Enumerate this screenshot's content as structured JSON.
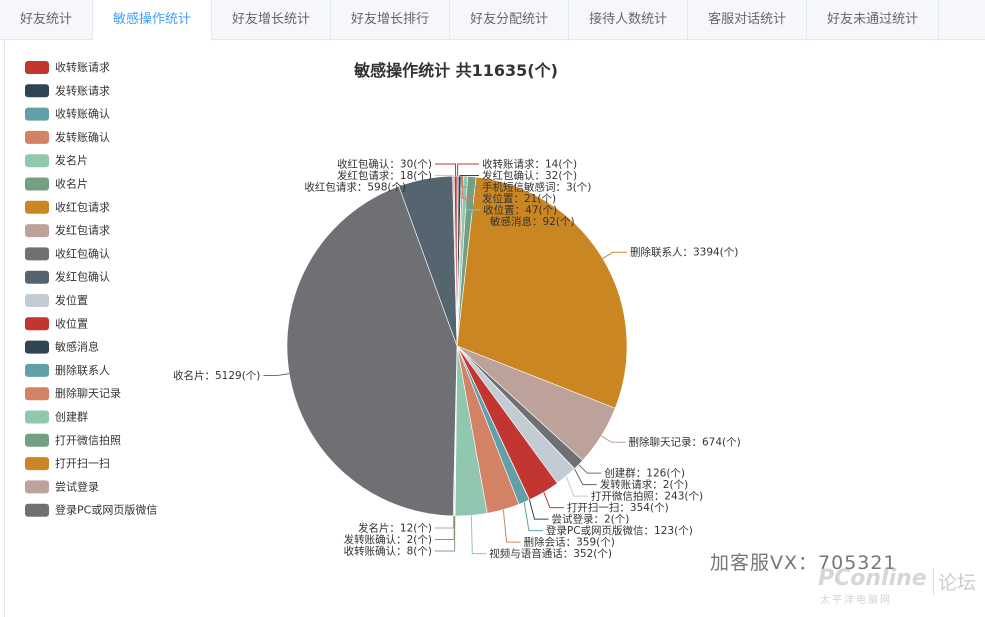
{
  "tabs": [
    {
      "label": "好友统计",
      "active": false
    },
    {
      "label": "敏感操作统计",
      "active": true
    },
    {
      "label": "好友增长统计",
      "active": false
    },
    {
      "label": "好友增长排行",
      "active": false
    },
    {
      "label": "好友分配统计",
      "active": false
    },
    {
      "label": "接待人数统计",
      "active": false
    },
    {
      "label": "客服对话统计",
      "active": false
    },
    {
      "label": "好友未通过统计",
      "active": false
    }
  ],
  "watermark": {
    "contact": "加客服VX：705321",
    "logo": "PConline",
    "logo_sub": "太平洋电脑网",
    "forum": "论坛"
  },
  "chart_data": {
    "type": "pie",
    "title": "敏感操作统计 共11635(个)",
    "unit": "(个)",
    "legend_position": "left",
    "legend": [
      {
        "name": "收转账请求",
        "color": "#c23531"
      },
      {
        "name": "发转账请求",
        "color": "#2f4554"
      },
      {
        "name": "收转账确认",
        "color": "#61a0a8"
      },
      {
        "name": "发转账确认",
        "color": "#d48265"
      },
      {
        "name": "发名片",
        "color": "#91c7ae"
      },
      {
        "name": "收名片",
        "color": "#749f83"
      },
      {
        "name": "收红包请求",
        "color": "#ca8622"
      },
      {
        "name": "发红包请求",
        "color": "#bda29a"
      },
      {
        "name": "收红包确认",
        "color": "#6e7074"
      },
      {
        "name": "发红包确认",
        "color": "#546570"
      },
      {
        "name": "发位置",
        "color": "#c4ccd3"
      },
      {
        "name": "收位置",
        "color": "#c23531"
      },
      {
        "name": "敏感消息",
        "color": "#2f4554"
      },
      {
        "name": "删除联系人",
        "color": "#61a0a8"
      },
      {
        "name": "删除聊天记录",
        "color": "#d48265"
      },
      {
        "name": "创建群",
        "color": "#91c7ae"
      },
      {
        "name": "打开微信拍照",
        "color": "#749f83"
      },
      {
        "name": "打开扫一扫",
        "color": "#ca8622"
      },
      {
        "name": "尝试登录",
        "color": "#bda29a"
      },
      {
        "name": "登录PC或网页版微信",
        "color": "#6e7074"
      }
    ],
    "slices": [
      {
        "name": "收转账请求",
        "value": 14,
        "color": "#c23531"
      },
      {
        "name": "发红包确认",
        "value": 32,
        "color": "#2f4554"
      },
      {
        "name": "手机短信敏感词",
        "value": 3,
        "color": "#61a0a8"
      },
      {
        "name": "发位置",
        "value": 21,
        "color": "#d48265"
      },
      {
        "name": "收位置",
        "value": 47,
        "color": "#91c7ae"
      },
      {
        "name": "敏感消息",
        "value": 92,
        "color": "#749f83"
      },
      {
        "name": "删除联系人",
        "value": 3394,
        "color": "#ca8622"
      },
      {
        "name": "删除聊天记录",
        "value": 674,
        "color": "#bda29a"
      },
      {
        "name": "创建群",
        "value": 126,
        "color": "#6e7074"
      },
      {
        "name": "发转账请求",
        "value": 2,
        "color": "#546570"
      },
      {
        "name": "打开微信拍照",
        "value": 243,
        "color": "#c4ccd3"
      },
      {
        "name": "打开扫一扫",
        "value": 354,
        "color": "#c23531"
      },
      {
        "name": "尝试登录",
        "value": 2,
        "color": "#2f4554"
      },
      {
        "name": "登录PC或网页版微信",
        "value": 123,
        "color": "#61a0a8"
      },
      {
        "name": "删除会话",
        "value": 359,
        "color": "#d48265"
      },
      {
        "name": "视频与语音通话",
        "value": 352,
        "color": "#91c7ae"
      },
      {
        "name": "收转账确认",
        "value": 8,
        "color": "#749f83"
      },
      {
        "name": "发转账确认",
        "value": 2,
        "color": "#ca8622"
      },
      {
        "name": "发名片",
        "value": 12,
        "color": "#bda29a"
      },
      {
        "name": "收名片",
        "value": 5129,
        "color": "#6e7074"
      },
      {
        "name": "收红包请求",
        "value": 598,
        "color": "#546570"
      },
      {
        "name": "发红包请求",
        "value": 18,
        "color": "#c4ccd3"
      },
      {
        "name": "收红包确认",
        "value": 30,
        "color": "#c23531"
      }
    ]
  }
}
